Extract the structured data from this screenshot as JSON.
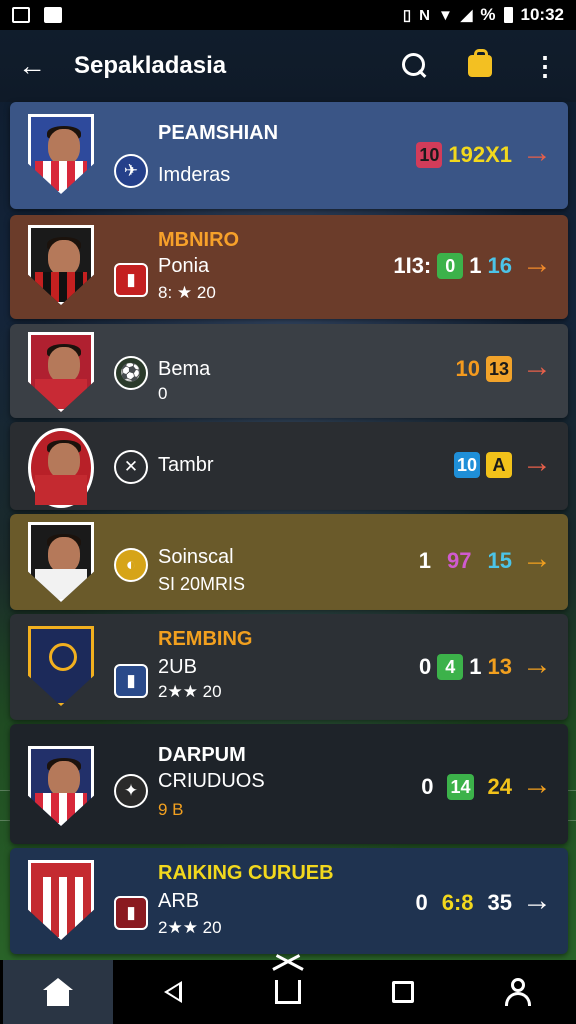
{
  "status_bar": {
    "time": "10:32",
    "battery_percent": "%"
  },
  "app_bar": {
    "title": "Sepakladasia"
  },
  "cards": [
    {
      "name": "PEAMSHIAN",
      "subtitle": "Imderas",
      "meta": "",
      "stats": [
        "10",
        "192X1"
      ],
      "bg": "#3a5586",
      "name_color": "#ffffff",
      "chip1_bg": "#d23c5a",
      "stats_colors": [
        "#ffffff",
        "#f2d81d"
      ]
    },
    {
      "name": "MBNIRO",
      "subtitle": "Ponia",
      "meta": "8: ★ 20",
      "stats": [
        "1I3:",
        "0",
        "1",
        "16"
      ],
      "bg": "#6b3c2a",
      "name_color": "#f7a12a",
      "chip1_bg": "#3cb24a",
      "stats_colors": [
        "#ffffff",
        "#ffffff",
        "#ffffff",
        "#4cc4e8"
      ]
    },
    {
      "name": "",
      "subtitle": "Bema",
      "meta": "0",
      "stats": [
        "10",
        "13"
      ],
      "bg": "#3a3f45",
      "name_color": "#ffffff",
      "chip1_bg": "#f2a32a",
      "stats_colors": [
        "#f49a1e",
        "#f2a32a"
      ]
    },
    {
      "name": "",
      "subtitle": "Tambr",
      "meta": "",
      "stats": [
        "10",
        "A"
      ],
      "bg": "#2a2d31",
      "name_color": "#ffffff",
      "chip1_bg": "#1f8fd8",
      "stats_colors": [
        "#ffffff",
        "#f2c21a"
      ]
    },
    {
      "name": "",
      "subtitle": "Soinscal",
      "meta": "SI 20MRIS",
      "stats": [
        "1",
        "97",
        "15"
      ],
      "bg": "#6a5a2a",
      "name_color": "#ffffff",
      "chip1_bg": "#6a5a2a",
      "stats_colors": [
        "#ffffff",
        "#d05ad0",
        "#4cc4e8"
      ]
    },
    {
      "name": "REMBING",
      "subtitle": "2UB",
      "meta": "2★★ 20",
      "stats": [
        "0",
        "4",
        "1",
        "13"
      ],
      "bg": "#2c3035",
      "name_color": "#f2a01f",
      "chip1_bg": "#3cb24a",
      "stats_colors": [
        "#ffffff",
        "#ffffff",
        "#ffffff",
        "#f2a01f"
      ]
    },
    {
      "name": "DARPUM",
      "subtitle": "CRIUDUOS",
      "meta": "9  B",
      "stats": [
        "0",
        "14",
        "24"
      ],
      "bg": "#1e2329",
      "name_color": "#ffffff",
      "chip1_bg": "#3cb24a",
      "stats_colors": [
        "#ffffff",
        "#ffffff",
        "#f2c21a"
      ]
    },
    {
      "name": "RAIKING CURUEB",
      "subtitle": "ARB",
      "meta": "2★★ 20",
      "stats": [
        "0",
        "6:8",
        "35"
      ],
      "bg": "#1f3350",
      "name_color": "#f2d81d",
      "chip1_bg": "#1f3350",
      "stats_colors": [
        "#ffffff",
        "#f2d81d",
        "#ffffff"
      ]
    }
  ],
  "nav": {
    "items": [
      "home",
      "back",
      "home-button",
      "recents",
      "profile"
    ]
  }
}
